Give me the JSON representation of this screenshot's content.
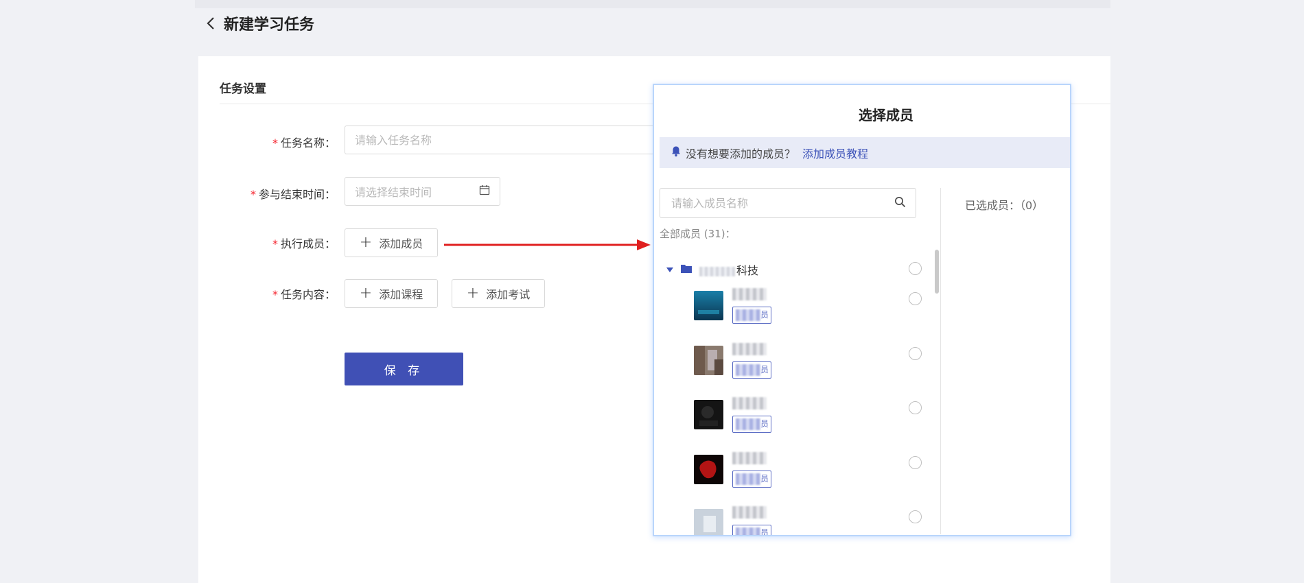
{
  "header": {
    "title": "新建学习任务",
    "back_icon": "chevron-left-icon"
  },
  "form": {
    "section_title": "任务设置",
    "required_mark": "*",
    "task_name": {
      "label": "任务名称：",
      "placeholder": "请输入任务名称",
      "value": ""
    },
    "end_time": {
      "label": "参与结束时间：",
      "placeholder": "请选择结束时间",
      "icon": "calendar-icon"
    },
    "executors": {
      "label": "执行成员：",
      "add_label": "添加成员"
    },
    "content": {
      "label": "任务内容：",
      "add_course_label": "添加课程",
      "add_exam_label": "添加考试"
    },
    "plus_glyph": "+",
    "save_label": "保 存"
  },
  "dialog": {
    "title": "选择成员",
    "notice": {
      "icon": "bell-icon",
      "text": "没有想要添加的成员？",
      "link": "添加成员教程"
    },
    "search": {
      "placeholder": "请输入成员名称",
      "icon": "search-icon"
    },
    "all_members_label": "全部成员 (31)：",
    "group": {
      "name_suffix": "科技",
      "expanded": true,
      "icon": "folder-icon"
    },
    "members": [
      {
        "tag_suffix": "员"
      },
      {
        "tag_suffix": "员"
      },
      {
        "tag_suffix": "员"
      },
      {
        "tag_suffix": "员"
      },
      {
        "tag_suffix": "员"
      }
    ],
    "selected_label": "已选成员：（0）"
  },
  "colors": {
    "primary": "#4050b5",
    "link": "#3c52b8",
    "required": "#f5222d",
    "arrow": "#e02020",
    "notice_bg": "#e8ebf7"
  }
}
